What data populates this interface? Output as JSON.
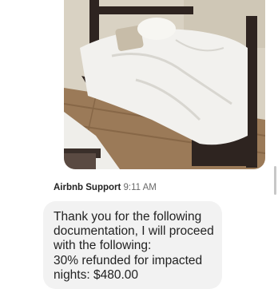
{
  "attachment": {
    "image_alt": "Photo of an unmade bed with a white duvet on a hardwood floor"
  },
  "message": {
    "sender": "Airbnb Support",
    "time": "9:11 AM",
    "lines": [
      "Thank you for the following",
      "documentation, I will proceed",
      "with the following:",
      "30% refunded for impacted",
      "nights: $480.00"
    ]
  },
  "colors": {
    "bubble": "#f2f2f2",
    "text": "#222222",
    "meta": "#6a6a6a"
  }
}
